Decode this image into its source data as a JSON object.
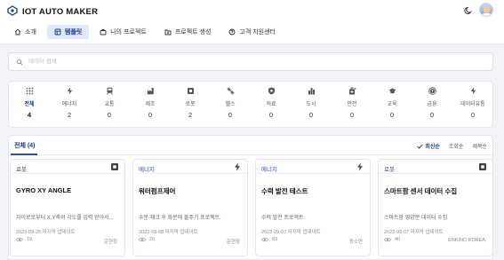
{
  "app": {
    "title": "IOT AUTO MAKER"
  },
  "nav": {
    "items": [
      {
        "label": "소개",
        "icon": "home-icon",
        "active": false
      },
      {
        "label": "템플릿",
        "icon": "template-icon",
        "active": true
      },
      {
        "label": "나의 프로젝트",
        "icon": "briefcase-icon",
        "active": false
      },
      {
        "label": "프로젝트 생성",
        "icon": "folder-plus-icon",
        "active": false
      },
      {
        "label": "고객 지원센터",
        "icon": "help-circle-icon",
        "active": false
      }
    ]
  },
  "search": {
    "placeholder": "데이터 검색",
    "value": ""
  },
  "categories": [
    {
      "label": "전체",
      "count": "4",
      "icon": "grid-icon",
      "active": true
    },
    {
      "label": "에너지",
      "count": "2",
      "icon": "bolt-icon"
    },
    {
      "label": "교통",
      "count": "0",
      "icon": "train-icon"
    },
    {
      "label": "제조",
      "count": "0",
      "icon": "factory-icon"
    },
    {
      "label": "로봇",
      "count": "2",
      "icon": "chip-icon"
    },
    {
      "label": "헬스",
      "count": "0",
      "icon": "dumbbell-icon"
    },
    {
      "label": "의료",
      "count": "0",
      "icon": "shield-icon"
    },
    {
      "label": "도시",
      "count": "0",
      "icon": "city-icon"
    },
    {
      "label": "안전",
      "count": "0",
      "icon": "safety-icon"
    },
    {
      "label": "교육",
      "count": "0",
      "icon": "graduation-icon"
    },
    {
      "label": "금융",
      "count": "0",
      "icon": "coin-icon"
    },
    {
      "label": "데이터유통",
      "count": "0",
      "icon": "bolt-icon"
    }
  ],
  "list": {
    "tab_label": "전체 (4)",
    "sort_options": [
      "최신순",
      "조회순",
      "제목순"
    ],
    "cards": [
      {
        "category": "로봇",
        "icon": "chip-icon",
        "title": "GYRO XY ANGLE",
        "desc": "자이로로부터 X,Y축의 각도를 입력 받아서...",
        "date": "2023-09-25 마지막 업데이트",
        "views": "19",
        "author": "운현정"
      },
      {
        "category": "에너지",
        "icon": "bolt-icon",
        "title": "워터펌프제어",
        "desc": "수분 체크 후 화분에 물주기 프로젝트.",
        "date": "2023-09-08 마지막 업데이트",
        "views": "20",
        "author": "운현정"
      },
      {
        "category": "에너지",
        "icon": "bolt-icon",
        "title": "수력 발전 테스트",
        "desc": "수력 발전 프로젝트",
        "date": "2023-09-07 마지막 업데이트",
        "views": "83",
        "author": "장소연"
      },
      {
        "category": "로봇",
        "icon": "chip-icon",
        "title": "스마트팜 센서 데이터 수집",
        "desc": "스마트팜 영양분 데이터 수집",
        "date": "2023-09-07 마지막 업데이트",
        "views": "40",
        "author": "ENKINO KOREA"
      }
    ]
  },
  "colors": {
    "accent": "#2c4aa0",
    "nav_active_bg": "#dfe7fb",
    "background": "#f3f4f7"
  }
}
